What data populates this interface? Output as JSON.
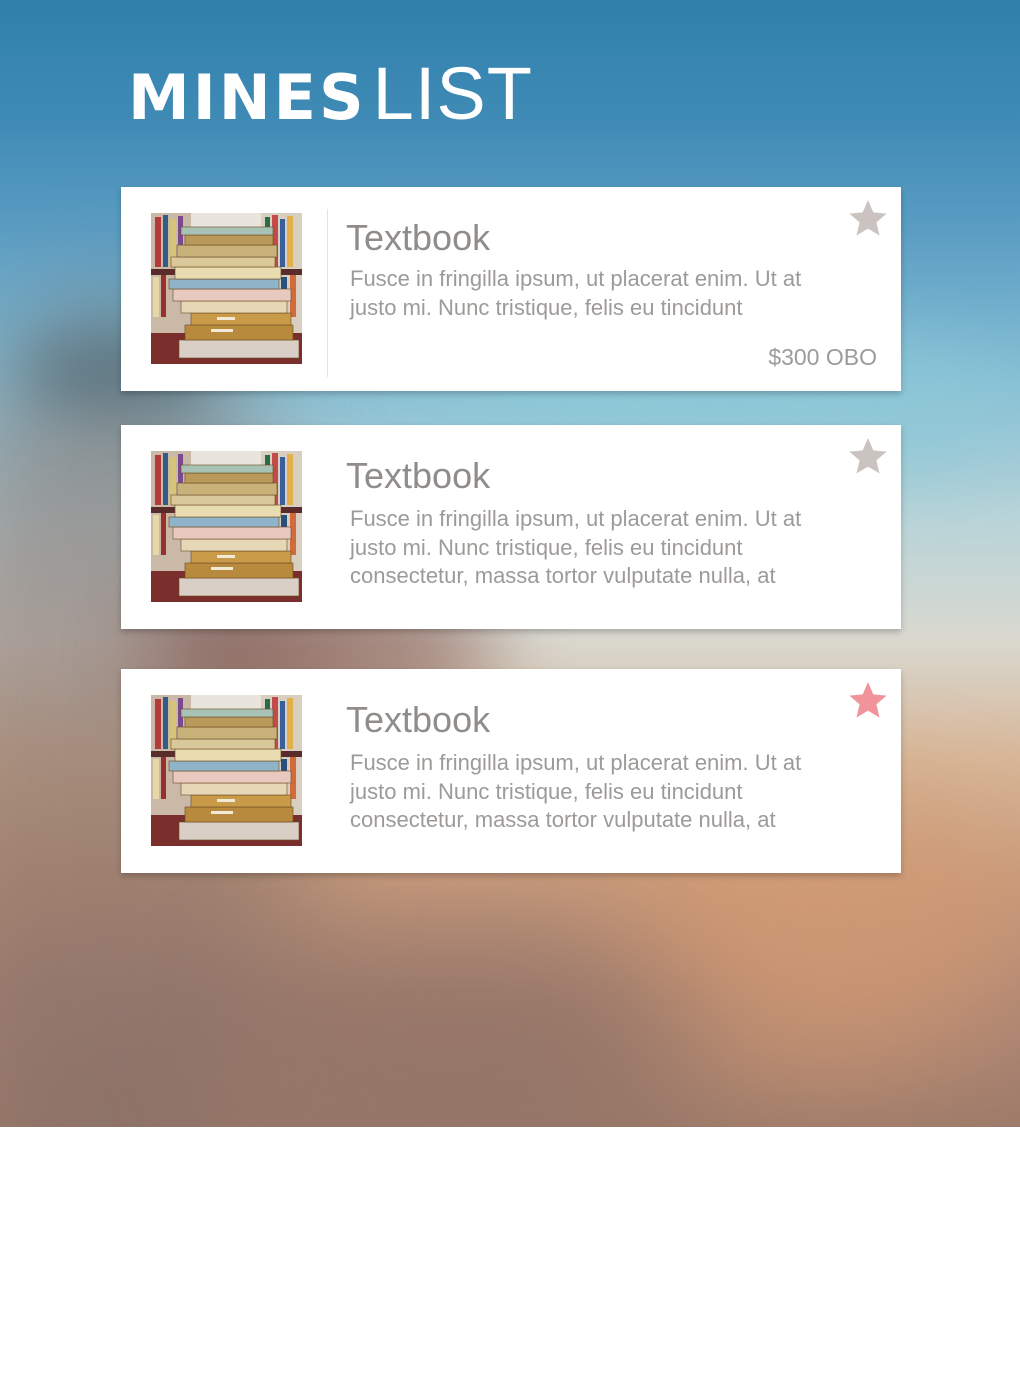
{
  "brand": {
    "bold": "MINES",
    "light": "LIST"
  },
  "colors": {
    "star_default": "#cbc3c0",
    "star_active": "#f0939a",
    "text": "#9d9a98"
  },
  "listings": [
    {
      "title": "Textbook",
      "desc_lines": [
        "Fusce in fringilla ipsum, ut placerat enim. Ut at",
        "justo mi. Nunc tristique, felis eu tincidunt",
        ""
      ],
      "price": "$300 OBO",
      "favorited": false,
      "star_icon": "star-icon",
      "image_icon": "book-stack-image"
    },
    {
      "title": "Textbook",
      "desc_lines": [
        "Fusce in fringilla ipsum, ut placerat enim. Ut at",
        "justo mi. Nunc tristique, felis eu tincidunt",
        "consectetur, massa tortor vulputate nulla, at"
      ],
      "price": "",
      "favorited": false,
      "star_icon": "star-icon",
      "image_icon": "book-stack-image"
    },
    {
      "title": "Textbook",
      "desc_lines": [
        "Fusce in fringilla ipsum, ut placerat enim. Ut at",
        "justo mi. Nunc tristique, felis eu tincidunt",
        "consectetur, massa tortor vulputate nulla, at"
      ],
      "price": "",
      "favorited": true,
      "star_icon": "star-icon",
      "image_icon": "book-stack-image"
    }
  ]
}
